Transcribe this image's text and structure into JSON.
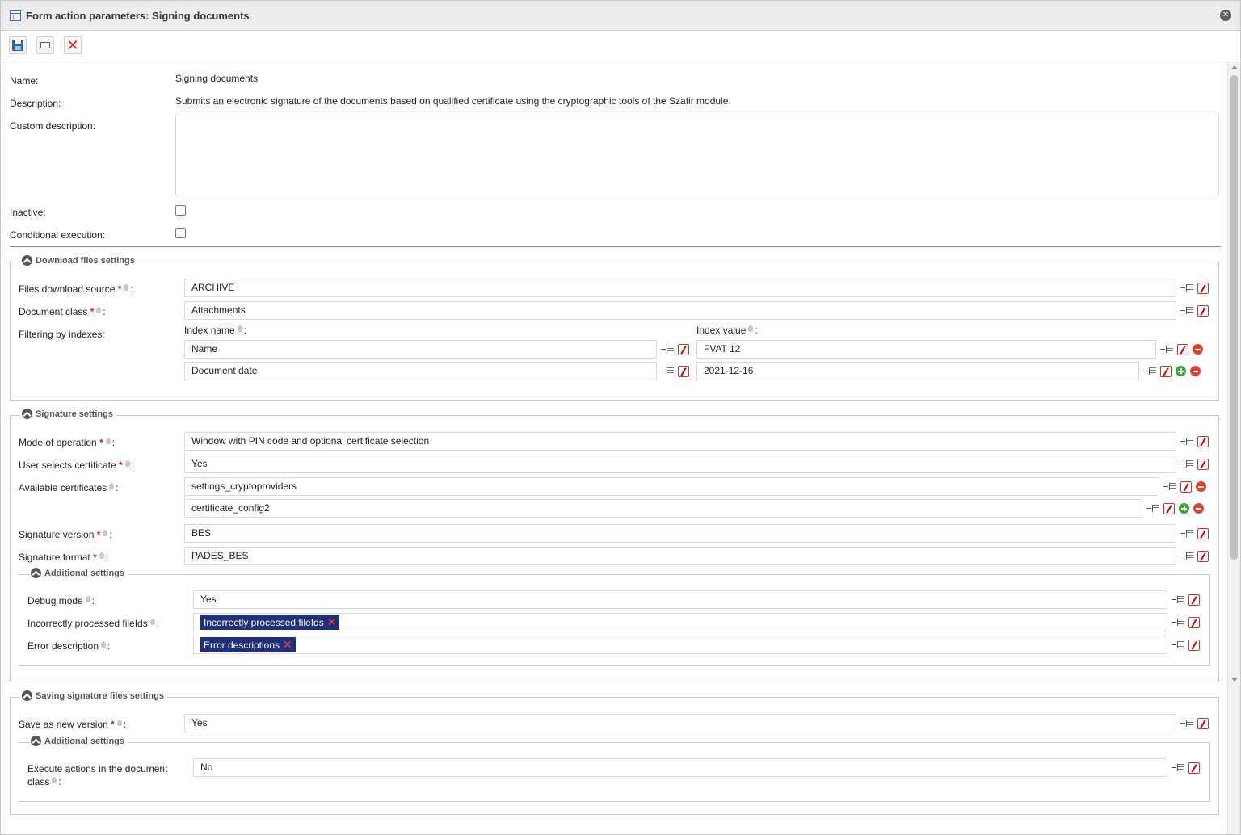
{
  "window": {
    "title": "Form action parameters: Signing documents"
  },
  "general": {
    "name_label": "Name:",
    "name_value": "Signing documents",
    "description_label": "Description:",
    "description_value": "Submits an electronic signature of the documents based on qualified certificate using the cryptographic tools of the Szafir module.",
    "custom_description_label": "Custom description:",
    "custom_description_value": "",
    "inactive_label": "Inactive:",
    "conditional_label": "Conditional execution:"
  },
  "download": {
    "legend": "Download files settings",
    "source_label": "Files download source",
    "source_value": "ARCHIVE",
    "class_label": "Document class",
    "class_value": "Attachments",
    "filter_label": "Filtering by indexes:",
    "index_name_label": "Index name",
    "index_value_label": "Index value",
    "rows": [
      {
        "name": "Name",
        "value": "FVAT 12"
      },
      {
        "name": "Document date",
        "value": "2021-12-16"
      }
    ]
  },
  "signature": {
    "legend": "Signature settings",
    "mode_label": "Mode of operation",
    "mode_value": "Window with PIN code and optional certificate selection",
    "user_selects_label": "User selects certificate",
    "user_selects_value": "Yes",
    "available_label": "Available certificates",
    "available_values": [
      "settings_cryptoproviders",
      "certificate_config2"
    ],
    "version_label": "Signature version",
    "version_value": "BES",
    "format_label": "Signature format",
    "format_value": "PADES_BES",
    "additional": {
      "legend": "Additional settings",
      "debug_label": "Debug mode",
      "debug_value": "Yes",
      "incorrect_label": "Incorrectly processed fileIds",
      "incorrect_chip": "Incorrectly processed fileIds",
      "error_label": "Error description",
      "error_chip": "Error descriptions"
    }
  },
  "saving": {
    "legend": "Saving signature files settings",
    "new_version_label": "Save as new version",
    "new_version_value": "Yes",
    "additional": {
      "legend": "Additional settings",
      "execute_label_1": "Execute actions in the document",
      "execute_label_2": "class",
      "execute_value": "No"
    }
  },
  "symbols": {
    "required": "*",
    "colon": ":",
    "close": "✕",
    "chip_remove": "✕"
  },
  "icons": [
    "window-icon",
    "close-icon",
    "save-icon",
    "preview-icon",
    "cancel-icon",
    "map-icon",
    "function-icon",
    "remove-icon",
    "add-icon",
    "hint-icon",
    "collapse-icon"
  ]
}
